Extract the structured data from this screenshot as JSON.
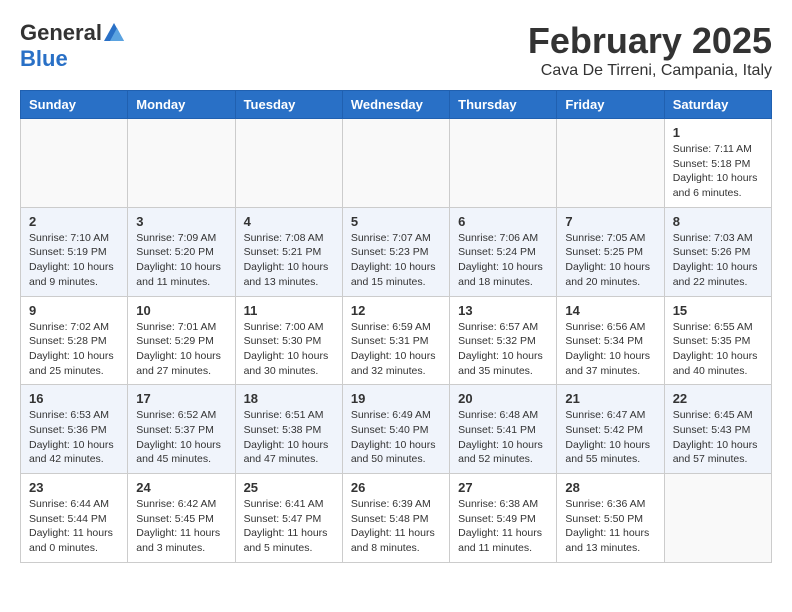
{
  "header": {
    "logo_general": "General",
    "logo_blue": "Blue",
    "month_title": "February 2025",
    "subtitle": "Cava De Tirreni, Campania, Italy"
  },
  "days_of_week": [
    "Sunday",
    "Monday",
    "Tuesday",
    "Wednesday",
    "Thursday",
    "Friday",
    "Saturday"
  ],
  "weeks": [
    [
      {
        "day": "",
        "info": ""
      },
      {
        "day": "",
        "info": ""
      },
      {
        "day": "",
        "info": ""
      },
      {
        "day": "",
        "info": ""
      },
      {
        "day": "",
        "info": ""
      },
      {
        "day": "",
        "info": ""
      },
      {
        "day": "1",
        "info": "Sunrise: 7:11 AM\nSunset: 5:18 PM\nDaylight: 10 hours\nand 6 minutes."
      }
    ],
    [
      {
        "day": "2",
        "info": "Sunrise: 7:10 AM\nSunset: 5:19 PM\nDaylight: 10 hours\nand 9 minutes."
      },
      {
        "day": "3",
        "info": "Sunrise: 7:09 AM\nSunset: 5:20 PM\nDaylight: 10 hours\nand 11 minutes."
      },
      {
        "day": "4",
        "info": "Sunrise: 7:08 AM\nSunset: 5:21 PM\nDaylight: 10 hours\nand 13 minutes."
      },
      {
        "day": "5",
        "info": "Sunrise: 7:07 AM\nSunset: 5:23 PM\nDaylight: 10 hours\nand 15 minutes."
      },
      {
        "day": "6",
        "info": "Sunrise: 7:06 AM\nSunset: 5:24 PM\nDaylight: 10 hours\nand 18 minutes."
      },
      {
        "day": "7",
        "info": "Sunrise: 7:05 AM\nSunset: 5:25 PM\nDaylight: 10 hours\nand 20 minutes."
      },
      {
        "day": "8",
        "info": "Sunrise: 7:03 AM\nSunset: 5:26 PM\nDaylight: 10 hours\nand 22 minutes."
      }
    ],
    [
      {
        "day": "9",
        "info": "Sunrise: 7:02 AM\nSunset: 5:28 PM\nDaylight: 10 hours\nand 25 minutes."
      },
      {
        "day": "10",
        "info": "Sunrise: 7:01 AM\nSunset: 5:29 PM\nDaylight: 10 hours\nand 27 minutes."
      },
      {
        "day": "11",
        "info": "Sunrise: 7:00 AM\nSunset: 5:30 PM\nDaylight: 10 hours\nand 30 minutes."
      },
      {
        "day": "12",
        "info": "Sunrise: 6:59 AM\nSunset: 5:31 PM\nDaylight: 10 hours\nand 32 minutes."
      },
      {
        "day": "13",
        "info": "Sunrise: 6:57 AM\nSunset: 5:32 PM\nDaylight: 10 hours\nand 35 minutes."
      },
      {
        "day": "14",
        "info": "Sunrise: 6:56 AM\nSunset: 5:34 PM\nDaylight: 10 hours\nand 37 minutes."
      },
      {
        "day": "15",
        "info": "Sunrise: 6:55 AM\nSunset: 5:35 PM\nDaylight: 10 hours\nand 40 minutes."
      }
    ],
    [
      {
        "day": "16",
        "info": "Sunrise: 6:53 AM\nSunset: 5:36 PM\nDaylight: 10 hours\nand 42 minutes."
      },
      {
        "day": "17",
        "info": "Sunrise: 6:52 AM\nSunset: 5:37 PM\nDaylight: 10 hours\nand 45 minutes."
      },
      {
        "day": "18",
        "info": "Sunrise: 6:51 AM\nSunset: 5:38 PM\nDaylight: 10 hours\nand 47 minutes."
      },
      {
        "day": "19",
        "info": "Sunrise: 6:49 AM\nSunset: 5:40 PM\nDaylight: 10 hours\nand 50 minutes."
      },
      {
        "day": "20",
        "info": "Sunrise: 6:48 AM\nSunset: 5:41 PM\nDaylight: 10 hours\nand 52 minutes."
      },
      {
        "day": "21",
        "info": "Sunrise: 6:47 AM\nSunset: 5:42 PM\nDaylight: 10 hours\nand 55 minutes."
      },
      {
        "day": "22",
        "info": "Sunrise: 6:45 AM\nSunset: 5:43 PM\nDaylight: 10 hours\nand 57 minutes."
      }
    ],
    [
      {
        "day": "23",
        "info": "Sunrise: 6:44 AM\nSunset: 5:44 PM\nDaylight: 11 hours\nand 0 minutes."
      },
      {
        "day": "24",
        "info": "Sunrise: 6:42 AM\nSunset: 5:45 PM\nDaylight: 11 hours\nand 3 minutes."
      },
      {
        "day": "25",
        "info": "Sunrise: 6:41 AM\nSunset: 5:47 PM\nDaylight: 11 hours\nand 5 minutes."
      },
      {
        "day": "26",
        "info": "Sunrise: 6:39 AM\nSunset: 5:48 PM\nDaylight: 11 hours\nand 8 minutes."
      },
      {
        "day": "27",
        "info": "Sunrise: 6:38 AM\nSunset: 5:49 PM\nDaylight: 11 hours\nand 11 minutes."
      },
      {
        "day": "28",
        "info": "Sunrise: 6:36 AM\nSunset: 5:50 PM\nDaylight: 11 hours\nand 13 minutes."
      },
      {
        "day": "",
        "info": ""
      }
    ]
  ]
}
